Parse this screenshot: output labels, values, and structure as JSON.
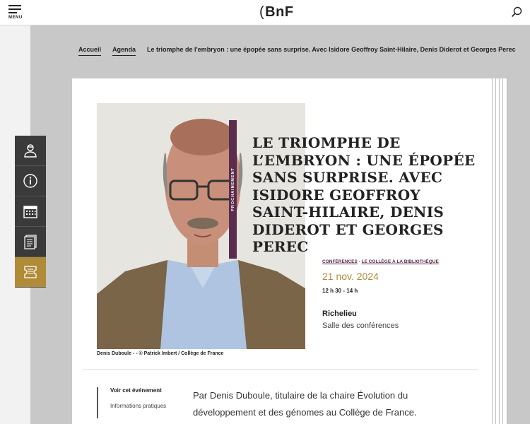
{
  "header": {
    "menu_label": "MENU",
    "logo_text": "BnF"
  },
  "side_tools": [
    {
      "icon": "user-icon"
    },
    {
      "icon": "info-icon"
    },
    {
      "icon": "calendar-icon"
    },
    {
      "icon": "document-icon"
    },
    {
      "icon": "ticket-icon"
    }
  ],
  "breadcrumb": {
    "home": "Accueil",
    "agenda": "Agenda",
    "current": "Le triomphe de l'embryon : une épopée sans surprise. Avec Isidore Geoffroy Saint-Hilaire, Denis Diderot et Georges Perec"
  },
  "event": {
    "badge": "PROCHAINEMENT",
    "title": "Le triomphe de l’embryon : une épopée sans surprise. Avec Isidore Geoffroy Saint-Hilaire, Denis Diderot et Georges Perec",
    "category_1": "Conférences",
    "category_sep": " - ",
    "category_2": "Le Collège à la bibliothèque",
    "date": "21 nov. 2024",
    "time": "12 h 30 - 14 h",
    "venue": "Richelieu",
    "room": "Salle des conférences",
    "photo_caption": "Denis Duboule - - © Patrick Imbert / Collège de France"
  },
  "subnav": [
    "Voir cet événement",
    "Informations pratiques"
  ],
  "intro": "Par Denis Duboule, titulaire de la chaire Évolution du développement et des génomes au Collège de France.",
  "colors": {
    "accent_purple": "#5a2c4e",
    "accent_gold": "#b08b38",
    "dark_tool": "#3a3a3a"
  }
}
